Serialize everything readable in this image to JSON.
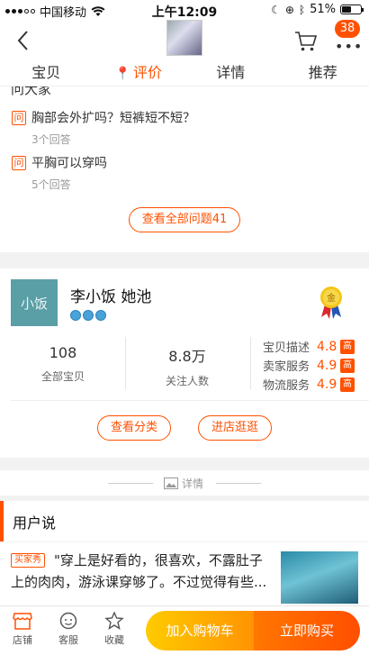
{
  "status_bar": {
    "carrier": "中国移动",
    "time": "上午12:09",
    "battery": "51%",
    "battery_level": 0.51
  },
  "header": {
    "cart_badge": "38",
    "more": "•••"
  },
  "tabs": [
    {
      "label": "宝贝"
    },
    {
      "label": "评价"
    },
    {
      "label": "详情"
    },
    {
      "label": "推荐"
    }
  ],
  "qa": {
    "cut_heading": "问大家",
    "tag": "问",
    "questions": [
      {
        "text": "胸部会外扩吗？短裤短不短？",
        "answers": "3个回答"
      },
      {
        "text": "平胸可以穿吗",
        "answers": "5个回答"
      }
    ],
    "view_all": "查看全部问题41"
  },
  "shop": {
    "logo_text": "小饭",
    "name": "李小饭 她池",
    "medal": "金",
    "stats": [
      {
        "value": "108",
        "label": "全部宝贝"
      },
      {
        "value": "8.8万",
        "label": "关注人数"
      }
    ],
    "ratings": [
      {
        "label": "宝贝描述",
        "value": "4.8",
        "tag": "高"
      },
      {
        "label": "卖家服务",
        "value": "4.9",
        "tag": "高"
      },
      {
        "label": "物流服务",
        "value": "4.9",
        "tag": "高"
      }
    ],
    "view_category": "查看分类",
    "enter_shop": "进店逛逛"
  },
  "detail_sep": "详情",
  "user_say": {
    "title": "用户说",
    "buyer_tag": "买家秀",
    "review": "\"穿上是好看的，很喜欢，不露肚子上的肉肉，游泳课穿够了。不过觉得有些..."
  },
  "bottom_bar": {
    "store": "店铺",
    "service": "客服",
    "favorite": "收藏",
    "add_cart": "加入购物车",
    "buy_now": "立即购买"
  },
  "colors": {
    "accent": "#ff5000",
    "cart_btn": "#ffb300",
    "buy_btn": "#ff5a00"
  }
}
